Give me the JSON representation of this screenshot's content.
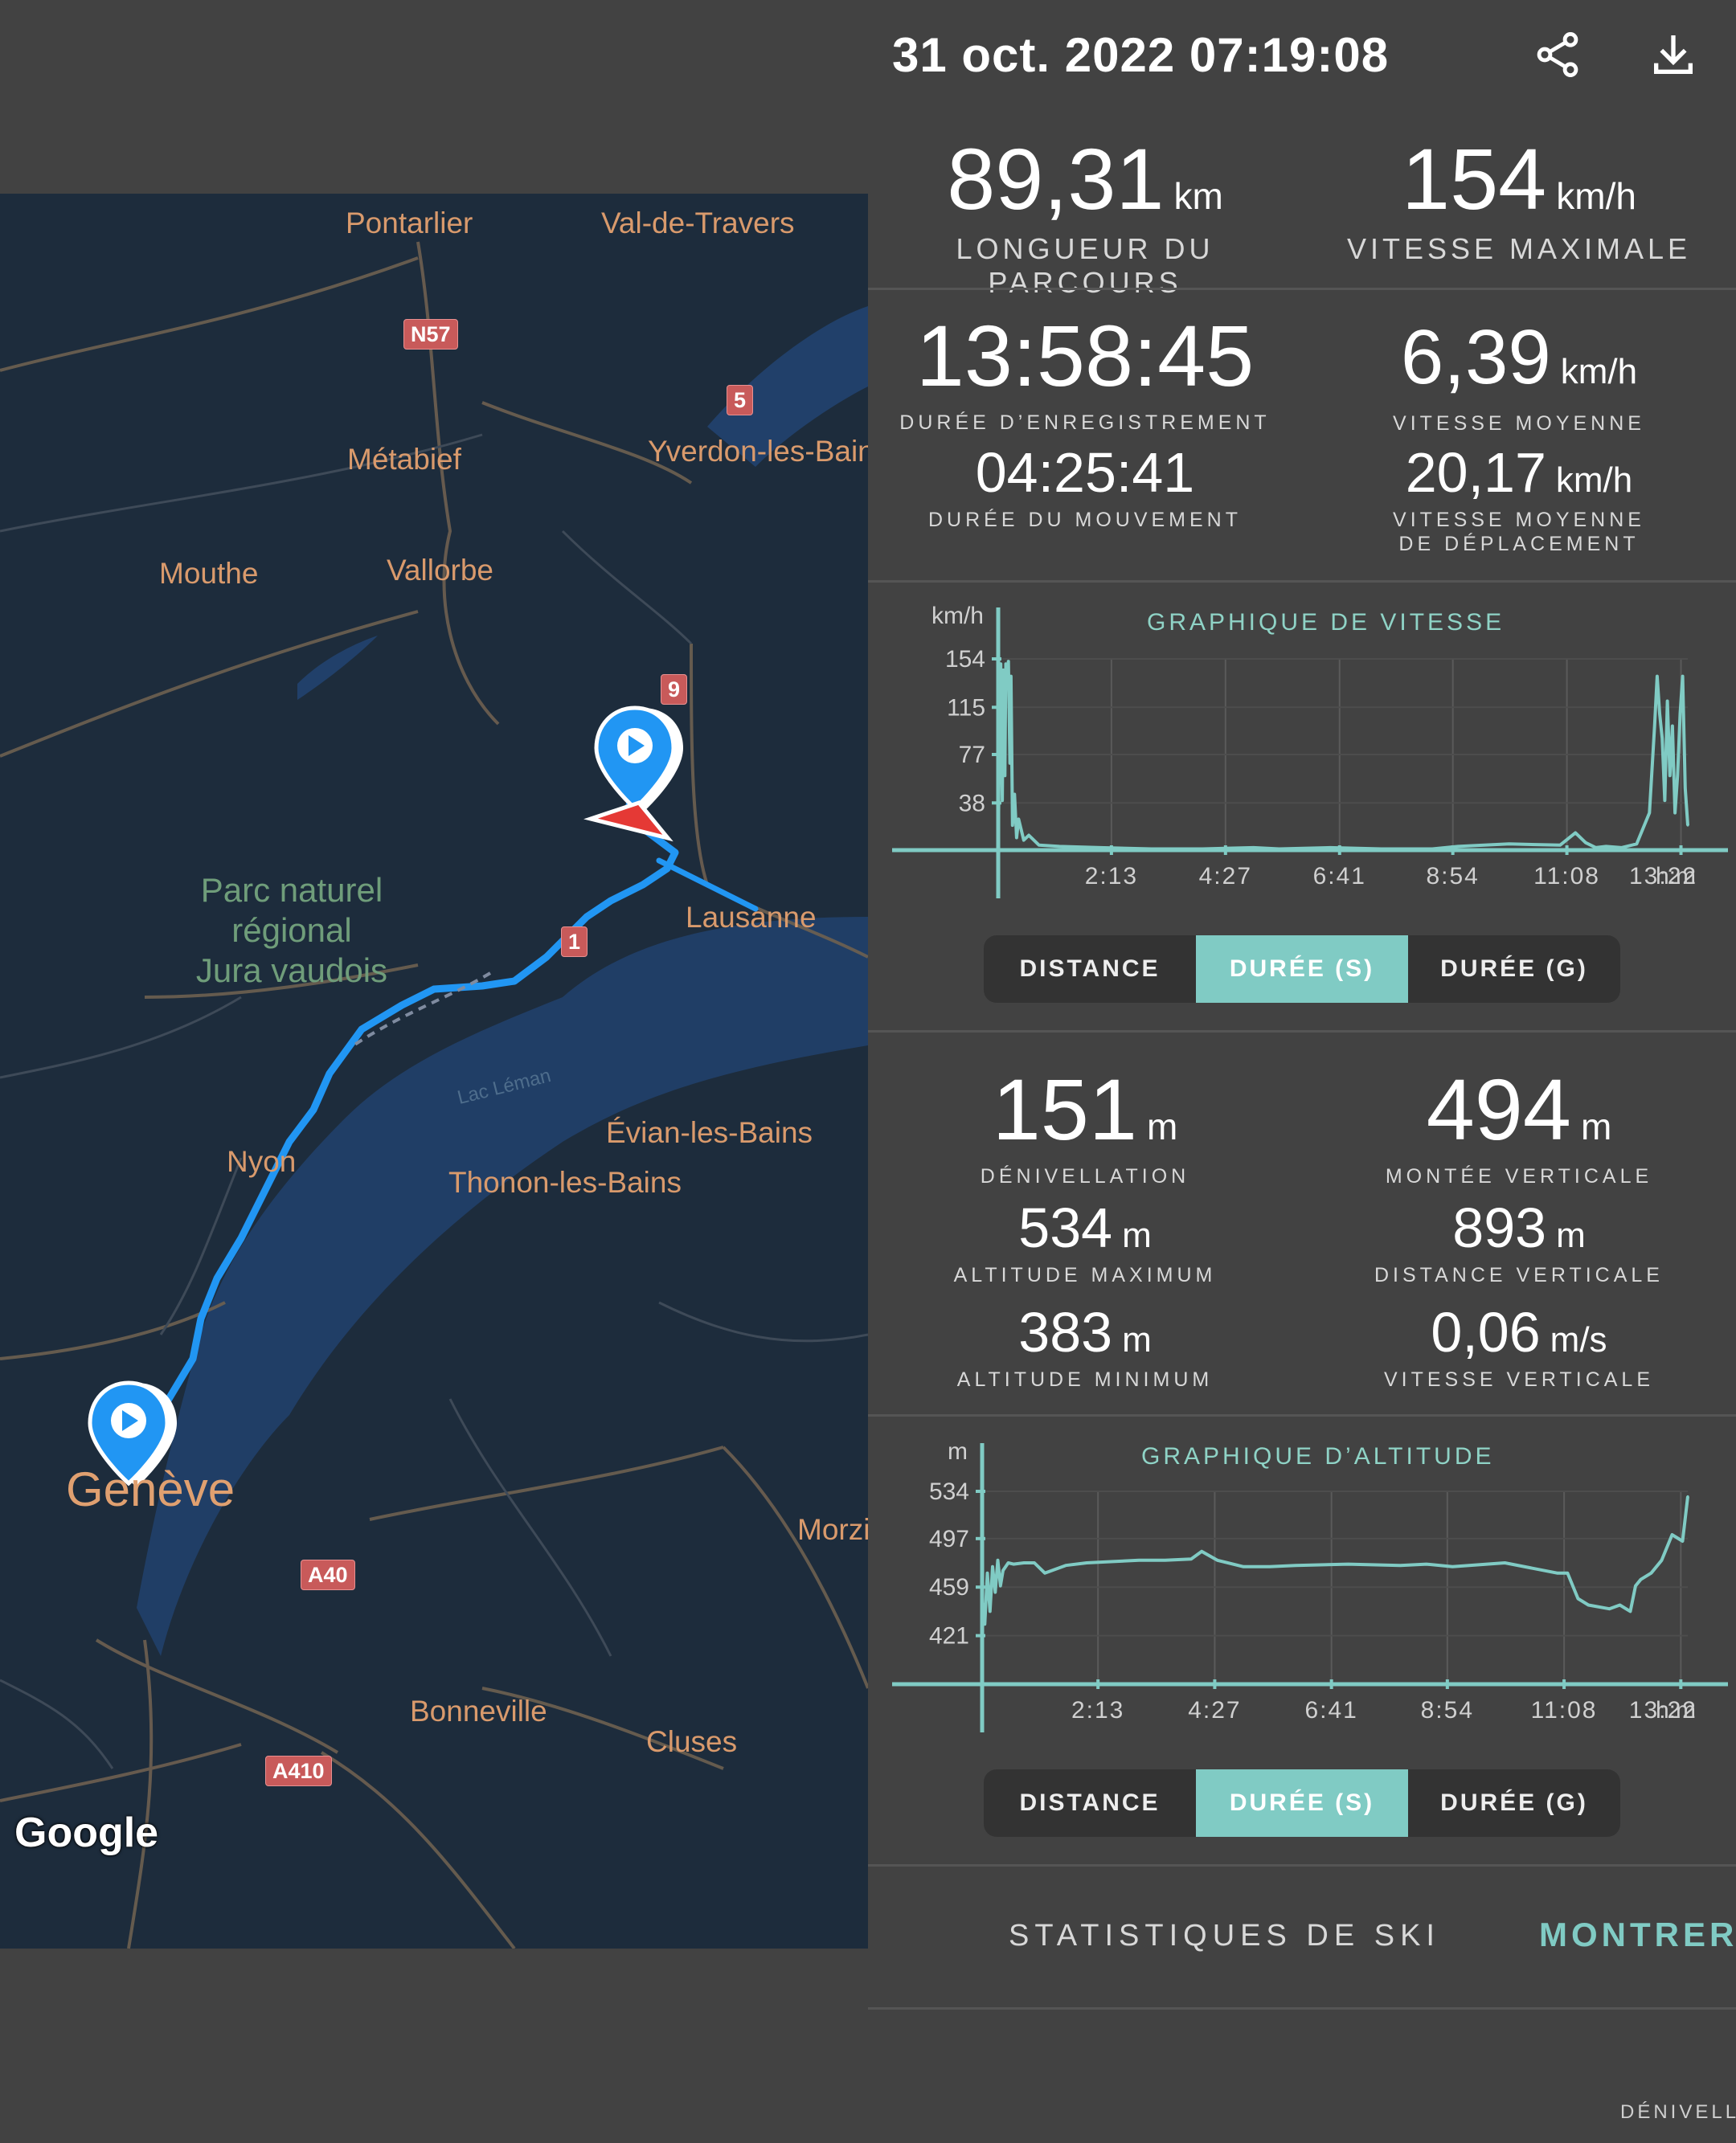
{
  "header": {
    "title": "31 oct. 2022 07:19:08"
  },
  "icons": {
    "share": "share-icon",
    "download": "download-icon"
  },
  "map": {
    "places": {
      "pontarlier": "Pontarlier",
      "val_de_travers": "Val-de-Travers",
      "metabief": "Métabief",
      "yverdon": "Yverdon-les-Bains",
      "mouthe": "Mouthe",
      "vallorbe": "Vallorbe",
      "lausanne": "Lausanne",
      "nyon": "Nyon",
      "evian": "Évian-les-Bains",
      "thonon": "Thonon-les-Bains",
      "geneve": "Genève",
      "morzine": "Morzi",
      "bonneville": "Bonneville",
      "cluses": "Cluses",
      "lac": "Lac Léman"
    },
    "park": [
      "Parc naturel",
      "régional",
      "Jura vaudois"
    ],
    "shields": {
      "n57": "N57",
      "r5": "5",
      "r9": "9",
      "r1": "1",
      "a40": "A40",
      "a410": "A410"
    },
    "logo": "Google"
  },
  "stats": {
    "distance": {
      "value": "89,31",
      "unit": "km",
      "label": "LONGUEUR DU PARCOURS"
    },
    "max_speed": {
      "value": "154",
      "unit": "km/h",
      "label": "VITESSE MAXIMALE"
    },
    "rec_duration": {
      "value": "13:58:45",
      "label": "DURÉE D’ENREGISTREMENT"
    },
    "avg_speed": {
      "value": "6,39",
      "unit": "km/h",
      "label": "VITESSE MOYENNE"
    },
    "move_duration": {
      "value": "04:25:41",
      "label": "DURÉE DU MOUVEMENT"
    },
    "avg_move_speed": {
      "value": "20,17",
      "unit": "km/h",
      "label": "VITESSE MOYENNE DE DÉPLACEMENT"
    },
    "denivellation": {
      "value": "151",
      "unit": "m",
      "label": "DÉNIVELLATION"
    },
    "vertical_ascent": {
      "value": "494",
      "unit": "m",
      "label": "MONTÉE VERTICALE"
    },
    "alt_max": {
      "value": "534",
      "unit": "m",
      "label": "ALTITUDE MAXIMUM"
    },
    "vert_distance": {
      "value": "893",
      "unit": "m",
      "label": "DISTANCE VERTICALE"
    },
    "alt_min": {
      "value": "383",
      "unit": "m",
      "label": "ALTITUDE MINIMUM"
    },
    "vert_speed": {
      "value": "0,06",
      "unit": "m/s",
      "label": "VITESSE VERTICALE"
    }
  },
  "segmented": {
    "distance": "DISTANCE",
    "duree_s": "DURÉE (S)",
    "duree_g": "DURÉE (G)"
  },
  "ski": {
    "label": "STATISTIQUES DE SKI",
    "button": "MONTRER"
  },
  "footer": {
    "text": "DÉNIVELL."
  },
  "colors": {
    "accent": "#80cbc4",
    "route": "#2196f3",
    "background": "#424242",
    "map": "#1d2c3c"
  },
  "chart_data": [
    {
      "type": "line",
      "title": "GRAPHIQUE DE VITESSE",
      "ylabel": "km/h",
      "xlabel_unit": "h:m",
      "ylim": [
        0,
        154
      ],
      "yticks": [
        "154",
        "115",
        "77",
        "38"
      ],
      "xticks": [
        "2:13",
        "4:27",
        "6:41",
        "8:54",
        "11:08",
        "13:22"
      ],
      "x_hours": [
        0,
        0.02,
        0.05,
        0.08,
        0.1,
        0.13,
        0.15,
        0.18,
        0.2,
        0.23,
        0.25,
        0.28,
        0.32,
        0.36,
        0.4,
        0.5,
        0.6,
        0.8,
        1.2,
        2.0,
        3.0,
        4.0,
        5.0,
        5.5,
        6.5,
        7.5,
        8.5,
        9.0,
        10.0,
        11.0,
        11.3,
        11.5,
        11.7,
        11.9,
        12.2,
        12.5,
        12.75,
        12.85,
        12.9,
        12.95,
        13.0,
        13.05,
        13.1,
        13.15,
        13.2,
        13.25,
        13.3,
        13.35,
        13.4,
        13.45,
        13.5
      ],
      "values": [
        0,
        80,
        150,
        40,
        145,
        60,
        150,
        130,
        152,
        70,
        140,
        20,
        45,
        10,
        25,
        8,
        12,
        4,
        3,
        2,
        1,
        1,
        2,
        1,
        2,
        1,
        1,
        3,
        5,
        4,
        14,
        6,
        2,
        3,
        2,
        5,
        30,
        100,
        140,
        110,
        90,
        40,
        120,
        60,
        100,
        30,
        60,
        110,
        140,
        50,
        20
      ]
    },
    {
      "type": "line",
      "title": "GRAPHIQUE D’ALTITUDE",
      "ylabel": "m",
      "xlabel_unit": "h:m",
      "ylim": [
        383,
        534
      ],
      "yticks": [
        "534",
        "497",
        "459",
        "421"
      ],
      "xticks": [
        "2:13",
        "4:27",
        "6:41",
        "8:54",
        "11:08",
        "13:22"
      ],
      "x_hours": [
        0,
        0.05,
        0.1,
        0.15,
        0.2,
        0.25,
        0.3,
        0.35,
        0.4,
        0.5,
        0.6,
        0.8,
        1.0,
        1.2,
        1.6,
        2.0,
        2.5,
        3.0,
        3.5,
        4.0,
        4.2,
        4.5,
        5.0,
        5.5,
        6.0,
        7.0,
        8.0,
        8.5,
        9.0,
        10.0,
        11.0,
        11.2,
        11.4,
        11.6,
        12.0,
        12.2,
        12.4,
        12.5,
        12.6,
        12.8,
        13.0,
        13.2,
        13.4,
        13.5
      ],
      "values": [
        450,
        430,
        470,
        440,
        475,
        455,
        480,
        460,
        472,
        478,
        477,
        478,
        478,
        470,
        476,
        478,
        479,
        480,
        480,
        481,
        487,
        480,
        475,
        475,
        476,
        477,
        476,
        477,
        475,
        478,
        470,
        470,
        450,
        445,
        442,
        445,
        440,
        460,
        465,
        470,
        480,
        500,
        495,
        530
      ]
    }
  ]
}
